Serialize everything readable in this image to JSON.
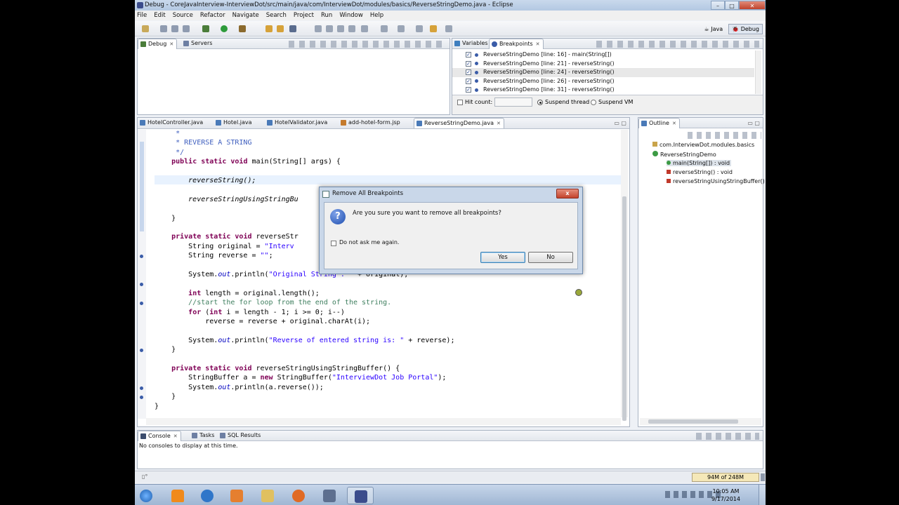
{
  "window": {
    "title": "Debug - CoreJavaInterview-InterviewDot/src/main/java/com/InterviewDot/modules/basics/ReverseStringDemo.java - Eclipse"
  },
  "menu": [
    "File",
    "Edit",
    "Source",
    "Refactor",
    "Navigate",
    "Search",
    "Project",
    "Run",
    "Window",
    "Help"
  ],
  "perspectives": {
    "java": "Java",
    "debug": "Debug"
  },
  "debug_view": {
    "tabs": [
      "Debug",
      "Servers"
    ]
  },
  "breakpoints_view": {
    "tabs": [
      "Variables",
      "Breakpoints"
    ],
    "items": [
      "ReverseStringDemo [line: 16] - main(String[])",
      "ReverseStringDemo [line: 21] - reverseString()",
      "ReverseStringDemo [line: 24] - reverseString()",
      "ReverseStringDemo [line: 26] - reverseString()",
      "ReverseStringDemo [line: 31] - reverseString()"
    ],
    "hit_count_label": "Hit count:",
    "suspend_thread": "Suspend thread",
    "suspend_vm": "Suspend VM"
  },
  "editor": {
    "tabs": [
      "HotelController.java",
      "Hotel.java",
      "HotelValidator.java",
      "add-hotel-form.jsp",
      "ReverseStringDemo.java"
    ],
    "lines": [
      "     *",
      "     * REVERSE A STRING",
      "     */",
      "    public static void main(String[] args) {",
      "",
      "        reverseString();",
      "",
      "        reverseStringUsingStringBu",
      "",
      "    }",
      "",
      "    private static void reverseStr",
      "        String original = \"Interv",
      "        String reverse = \"\";",
      "",
      "        System.out.println(\"Original String : \" + original);",
      "",
      "        int length = original.length();",
      "        //start the for loop from the end of the string.",
      "        for (int i = length - 1; i >= 0; i--)",
      "            reverse = reverse + original.charAt(i);",
      "",
      "        System.out.println(\"Reverse of entered string is: \" + reverse);",
      "    }",
      "",
      "    private static void reverseStringUsingStringBuffer() {",
      "        StringBuffer a = new StringBuffer(\"InterviewDot Job Portal\");",
      "        System.out.println(a.reverse());",
      "    }",
      "}"
    ]
  },
  "outline": {
    "tab": "Outline",
    "package": "com.InterviewDot.modules.basics",
    "class": "ReverseStringDemo",
    "members": [
      "main(String[]) : void",
      "reverseString() : void",
      "reverseStringUsingStringBuffer()"
    ]
  },
  "console": {
    "tabs": [
      "Console",
      "Tasks",
      "SQL Results"
    ],
    "message": "No consoles to display at this time."
  },
  "dialog": {
    "title": "Remove All Breakpoints",
    "message": "Are you sure you want to remove all breakpoints?",
    "checkbox": "Do not ask me again.",
    "yes": "Yes",
    "no": "No",
    "close": "x"
  },
  "status": {
    "heap": "94M of 248M"
  },
  "taskbar": {
    "time": "10:05 AM",
    "date": "9/17/2014"
  }
}
